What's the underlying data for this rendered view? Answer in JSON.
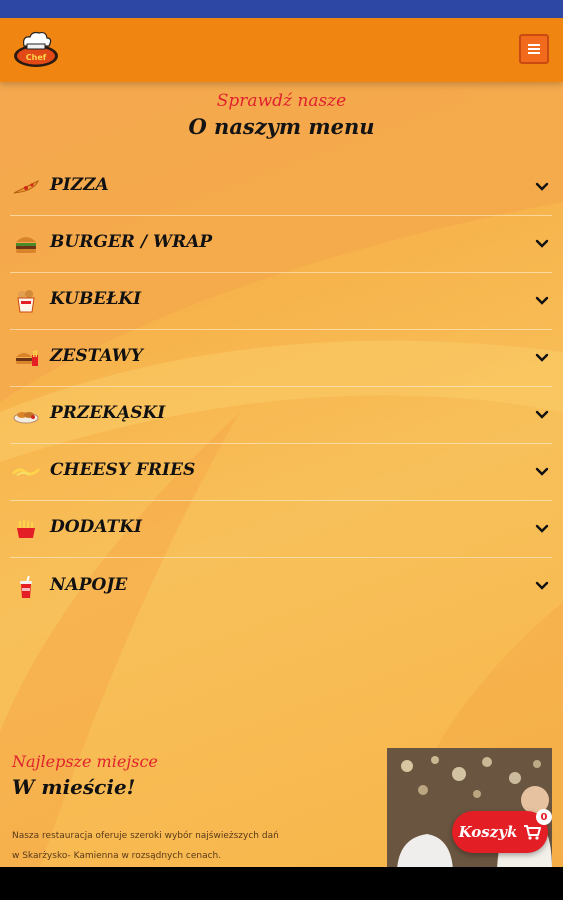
{
  "header": {
    "logo_text": "Chef",
    "menu_icon": "hamburger-icon"
  },
  "menu_section": {
    "subtitle": "Sprawdź nasze",
    "title": "O naszym menu",
    "items": [
      {
        "label": "PIZZA",
        "icon": "pizza-icon"
      },
      {
        "label": "BURGER / WRAP",
        "icon": "burger-icon"
      },
      {
        "label": "KUBEŁKI",
        "icon": "bucket-icon"
      },
      {
        "label": "ZESTAWY",
        "icon": "set-meal-icon"
      },
      {
        "label": "PRZEKĄSKI",
        "icon": "snack-icon"
      },
      {
        "label": "CHEESY FRIES",
        "icon": "cheesy-fries-icon"
      },
      {
        "label": "DODATKI",
        "icon": "fries-icon"
      },
      {
        "label": "NAPOJE",
        "icon": "drink-icon"
      }
    ]
  },
  "promo": {
    "subtitle": "Najlepsze miejsce",
    "title": "W mieście!",
    "text_line1": "Nasza restauracja oferuje szeroki wybór najświeższych dań",
    "text_line2": "w Skarżysko- Kamienna w rozsądnych cenach."
  },
  "cart": {
    "label": "Koszyk",
    "count": "0",
    "icon": "cart-icon"
  },
  "colors": {
    "status_bar": "#2d47a4",
    "header": "#f08512",
    "accent_red": "#e0212e",
    "background": "#f7b24a"
  }
}
